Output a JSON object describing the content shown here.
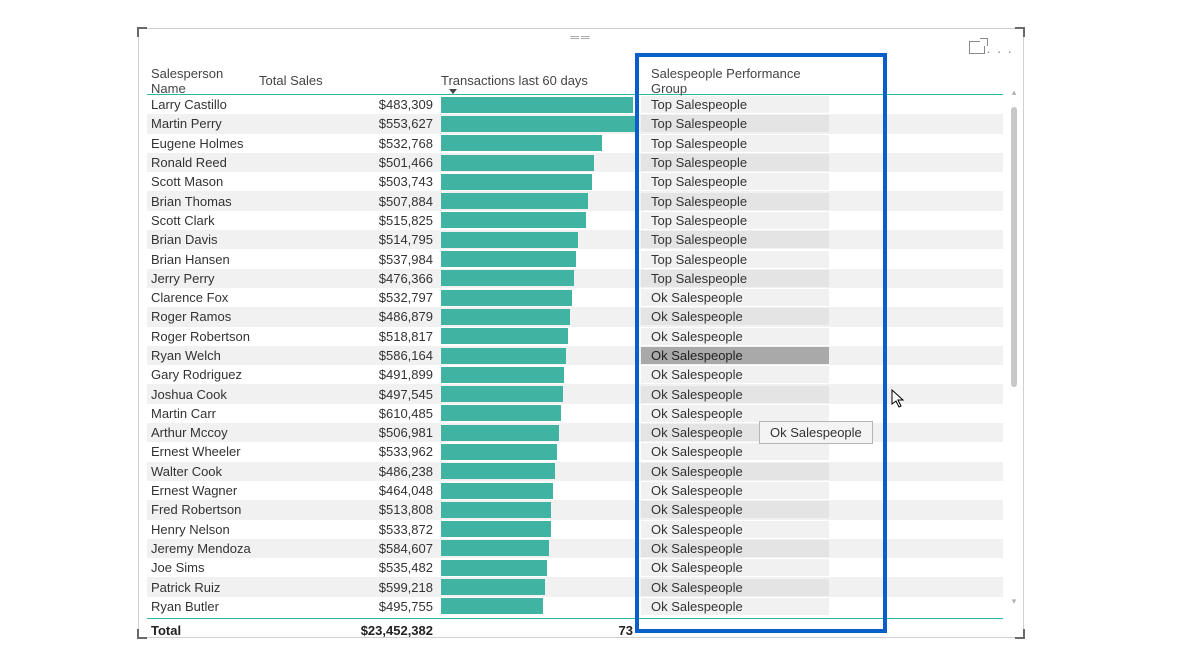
{
  "headers": {
    "name": "Salesperson Name",
    "sales": "Total Sales",
    "trans": "Transactions last 60 days",
    "group": "Salespeople Performance Group"
  },
  "rows": [
    {
      "name": "Larry Castillo",
      "sales": "$483,309",
      "bar": 98,
      "group": "Top Salespeople"
    },
    {
      "name": "Martin Perry",
      "sales": "$553,627",
      "bar": 100,
      "group": "Top Salespeople"
    },
    {
      "name": "Eugene Holmes",
      "sales": "$532,768",
      "bar": 82,
      "group": "Top Salespeople"
    },
    {
      "name": "Ronald Reed",
      "sales": "$501,466",
      "bar": 78,
      "group": "Top Salespeople"
    },
    {
      "name": "Scott Mason",
      "sales": "$503,743",
      "bar": 77,
      "group": "Top Salespeople"
    },
    {
      "name": "Brian Thomas",
      "sales": "$507,884",
      "bar": 75,
      "group": "Top Salespeople"
    },
    {
      "name": "Scott Clark",
      "sales": "$515,825",
      "bar": 74,
      "group": "Top Salespeople"
    },
    {
      "name": "Brian Davis",
      "sales": "$514,795",
      "bar": 70,
      "group": "Top Salespeople"
    },
    {
      "name": "Brian Hansen",
      "sales": "$537,984",
      "bar": 69,
      "group": "Top Salespeople"
    },
    {
      "name": "Jerry Perry",
      "sales": "$476,366",
      "bar": 68,
      "group": "Top Salespeople"
    },
    {
      "name": "Clarence Fox",
      "sales": "$532,797",
      "bar": 67,
      "group": "Ok Salespeople"
    },
    {
      "name": "Roger Ramos",
      "sales": "$486,879",
      "bar": 66,
      "group": "Ok Salespeople"
    },
    {
      "name": "Roger Robertson",
      "sales": "$518,817",
      "bar": 65,
      "group": "Ok Salespeople"
    },
    {
      "name": "Ryan Welch",
      "sales": "$586,164",
      "bar": 64,
      "group": "Ok Salespeople",
      "selected": true
    },
    {
      "name": "Gary Rodriguez",
      "sales": "$491,899",
      "bar": 63,
      "group": "Ok Salespeople"
    },
    {
      "name": "Joshua Cook",
      "sales": "$497,545",
      "bar": 62,
      "group": "Ok Salespeople"
    },
    {
      "name": "Martin Carr",
      "sales": "$610,485",
      "bar": 61,
      "group": "Ok Salespeople"
    },
    {
      "name": "Arthur Mccoy",
      "sales": "$506,981",
      "bar": 60,
      "group": "Ok Salespeople"
    },
    {
      "name": "Ernest Wheeler",
      "sales": "$533,962",
      "bar": 59,
      "group": "Ok Salespeople"
    },
    {
      "name": "Walter Cook",
      "sales": "$486,238",
      "bar": 58,
      "group": "Ok Salespeople"
    },
    {
      "name": "Ernest Wagner",
      "sales": "$464,048",
      "bar": 57,
      "group": "Ok Salespeople"
    },
    {
      "name": "Fred Robertson",
      "sales": "$513,808",
      "bar": 56,
      "group": "Ok Salespeople"
    },
    {
      "name": "Henry Nelson",
      "sales": "$533,872",
      "bar": 56,
      "group": "Ok Salespeople"
    },
    {
      "name": "Jeremy Mendoza",
      "sales": "$584,607",
      "bar": 55,
      "group": "Ok Salespeople"
    },
    {
      "name": "Joe Sims",
      "sales": "$535,482",
      "bar": 54,
      "group": "Ok Salespeople"
    },
    {
      "name": "Patrick Ruiz",
      "sales": "$599,218",
      "bar": 53,
      "group": "Ok Salespeople"
    },
    {
      "name": "Ryan Butler",
      "sales": "$495,755",
      "bar": 52,
      "group": "Ok Salespeople"
    }
  ],
  "total": {
    "label": "Total",
    "sales": "$23,452,382",
    "tx": "73"
  },
  "tooltip": "Ok Salespeople",
  "chart_data": {
    "type": "table",
    "title": "",
    "columns": [
      "Salesperson Name",
      "Total Sales",
      "Transactions last 60 days",
      "Salespeople Performance Group"
    ],
    "bar_column": "Transactions last 60 days"
  }
}
